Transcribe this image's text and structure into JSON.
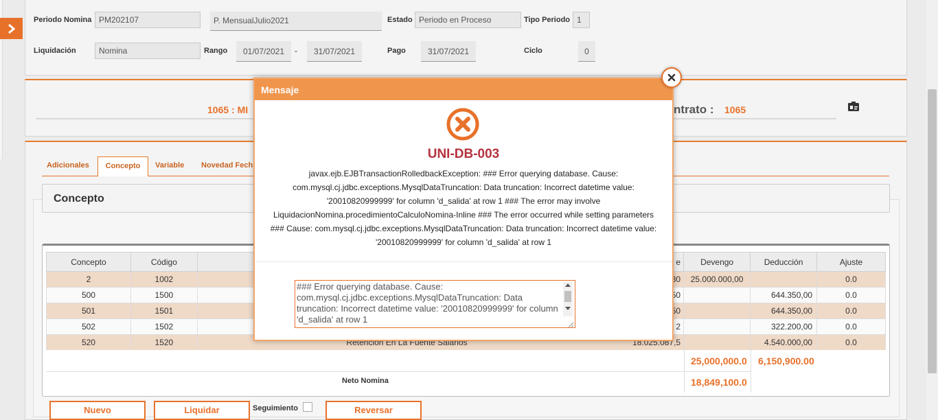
{
  "header": {
    "periodo_nomina_label": "Periodo Nomina",
    "periodo_nomina_value": "PM202107",
    "periodo_desc_value": "P. MensualJulio2021",
    "estado_label": "Estado",
    "estado_value": "Periodo en Proceso",
    "tipo_periodo_label": "Tipo Periodo",
    "tipo_periodo_value": "1",
    "liquidacion_label": "Liquidación",
    "liquidacion_value": "Nomina",
    "rango_label": "Rango",
    "rango_from": "01/07/2021",
    "rango_sep": "-",
    "rango_to": "31/07/2021",
    "pago_label": "Pago",
    "pago_value": "31/07/2021",
    "ciclo_label": "Ciclo",
    "ciclo_value": "0"
  },
  "employee": {
    "left_text": "1065 : MI",
    "contrato_label": "ntrato :",
    "contrato_value": "1065"
  },
  "tabs": [
    {
      "label": "Adicionales"
    },
    {
      "label": "Concepto"
    },
    {
      "label": "Variable"
    },
    {
      "label": "Novedad Fech"
    }
  ],
  "concepto_section": {
    "title": "Concepto"
  },
  "table": {
    "headers": [
      "Concepto",
      "Código",
      "",
      "e",
      "Devengo",
      "Deducción",
      "Ajuste"
    ],
    "rows": [
      {
        "concepto": "2",
        "codigo": "1002",
        "desc": "",
        "base": "30",
        "devengo": "25.000.000,00",
        "deduccion": "",
        "ajuste": "0.0"
      },
      {
        "concepto": "500",
        "codigo": "1500",
        "desc": "",
        "base": "50",
        "devengo": "",
        "deduccion": "644.350,00",
        "ajuste": "0.0"
      },
      {
        "concepto": "501",
        "codigo": "1501",
        "desc": "",
        "base": "50",
        "devengo": "",
        "deduccion": "644.350,00",
        "ajuste": "0.0"
      },
      {
        "concepto": "502",
        "codigo": "1502",
        "desc": "",
        "base": "2",
        "devengo": "",
        "deduccion": "322.200,00",
        "ajuste": "0.0"
      },
      {
        "concepto": "520",
        "codigo": "1520",
        "desc": "Retención En La Fuente Salarios",
        "base": "18.025.087,5",
        "devengo": "",
        "deduccion": "4.540.000,00",
        "ajuste": "0.0"
      }
    ],
    "total_devengo": "25,000,000.0",
    "total_deduccion": "6,150,900.00",
    "neto_label": "Neto Nomina",
    "neto_value": "18,849,100.0"
  },
  "buttons": {
    "nuevo": "Nuevo",
    "liquidar": "Liquidar",
    "seguimiento": "Seguimiento",
    "reversar": "Reversar"
  },
  "modal": {
    "title": "Mensaje",
    "code": "UNI-DB-003",
    "message_lines": [
      "javax.ejb.EJBTransactionRolledbackException: ### Error querying database. Cause:",
      "com.mysql.cj.jdbc.exceptions.MysqlDataTruncation: Data truncation: Incorrect datetime value:",
      "'20010820999999' for column 'd_salida' at row 1 ### The error may involve",
      "LiquidacionNomina.procedimientoCalculoNomina-Inline ### The error occurred while setting parameters",
      "### Cause: com.mysql.cj.jdbc.exceptions.MysqlDataTruncation: Data truncation: Incorrect datetime value:",
      "'20010820999999' for column 'd_salida' at row 1"
    ],
    "detail_text": "### Error querying database.  Cause: com.mysql.cj.jdbc.exceptions.MysqlDataTruncation: Data truncation: Incorrect datetime value: '20010820999999' for column 'd_salida' at row 1"
  },
  "colors": {
    "accent": "#e8712a",
    "modal_header": "#f0954c",
    "error_code": "#b5323e",
    "row_highlight": "#efd9c7"
  }
}
